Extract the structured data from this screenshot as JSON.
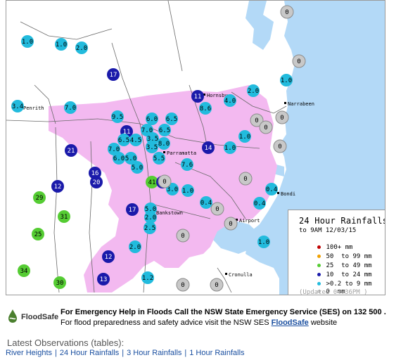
{
  "map": {
    "places": [
      {
        "name": "Penrith"
      },
      {
        "name": "Hornsby"
      },
      {
        "name": "Narrabeen"
      },
      {
        "name": "Parramatta"
      },
      {
        "name": "Bankstown"
      },
      {
        "name": "Bondi"
      },
      {
        "name": "Airport"
      },
      {
        "name": "Cronulla"
      }
    ],
    "stations": [
      {
        "label": "1.0",
        "cls": "0.2-9"
      },
      {
        "label": "1.0",
        "cls": "0.2-9"
      },
      {
        "label": "2.0",
        "cls": "0.2-9"
      },
      {
        "label": "17",
        "cls": "10-24"
      },
      {
        "label": "1.0",
        "cls": "0.2-9"
      },
      {
        "label": "11",
        "cls": "10-24"
      },
      {
        "label": "4.0",
        "cls": "0.2-9"
      },
      {
        "label": "2.0",
        "cls": "0.2-9"
      },
      {
        "label": "3.4",
        "cls": "0.2-9"
      },
      {
        "label": "7.0",
        "cls": "0.2-9"
      },
      {
        "label": "9.5",
        "cls": "0.2-9"
      },
      {
        "label": "6.0",
        "cls": "0.2-9"
      },
      {
        "label": "6.5",
        "cls": "0.2-9"
      },
      {
        "label": "8.6",
        "cls": "0.2-9"
      },
      {
        "label": "11",
        "cls": "10-24"
      },
      {
        "label": "7.0",
        "cls": "0.2-9"
      },
      {
        "label": "6.5",
        "cls": "0.2-9"
      },
      {
        "label": "6.5",
        "cls": "0.2-9"
      },
      {
        "label": "4.5",
        "cls": "0.2-9"
      },
      {
        "label": "3.5",
        "cls": "0.2-9"
      },
      {
        "label": "8.0",
        "cls": "0.2-9"
      },
      {
        "label": "3.5",
        "cls": "0.2-9"
      },
      {
        "label": "7.0",
        "cls": "0.2-9"
      },
      {
        "label": "6.0",
        "cls": "0.2-9"
      },
      {
        "label": "5.0",
        "cls": "0.2-9"
      },
      {
        "label": "5.0",
        "cls": "0.2-9"
      },
      {
        "label": "5.5",
        "cls": "0.2-9"
      },
      {
        "label": "21",
        "cls": "10-24"
      },
      {
        "label": "14",
        "cls": "10-24"
      },
      {
        "label": "1.0",
        "cls": "0.2-9"
      },
      {
        "label": "1.0",
        "cls": "0.2-9"
      },
      {
        "label": "7.6",
        "cls": "0.2-9"
      },
      {
        "label": "16",
        "cls": "10-24"
      },
      {
        "label": "20",
        "cls": "10-24"
      },
      {
        "label": "41",
        "cls": "25-49"
      },
      {
        "label": "11",
        "cls": "10-24"
      },
      {
        "label": "0.2",
        "cls": "0"
      },
      {
        "label": "12",
        "cls": "10-24"
      },
      {
        "label": "3.0",
        "cls": "0.2-9"
      },
      {
        "label": "1.0",
        "cls": "0.2-9"
      },
      {
        "label": "0.4",
        "cls": "0.2-9"
      },
      {
        "label": "29",
        "cls": "25-49"
      },
      {
        "label": "0.4",
        "cls": "0.2-9"
      },
      {
        "label": "0.4",
        "cls": "0.2-9"
      },
      {
        "label": "31",
        "cls": "25-49"
      },
      {
        "label": "17",
        "cls": "10-24"
      },
      {
        "label": "5.0",
        "cls": "0.2-9"
      },
      {
        "label": "2.0",
        "cls": "0.2-9"
      },
      {
        "label": "25",
        "cls": "25-49"
      },
      {
        "label": "2.5",
        "cls": "0.2-9"
      },
      {
        "label": "1.0",
        "cls": "0.2-9"
      },
      {
        "label": "2.0",
        "cls": "0.2-9"
      },
      {
        "label": "12",
        "cls": "10-24"
      },
      {
        "label": "34",
        "cls": "25-49"
      },
      {
        "label": "1.2",
        "cls": "0.2-9"
      },
      {
        "label": "30",
        "cls": "25-49"
      },
      {
        "label": "13",
        "cls": "10-24"
      },
      {
        "label": "",
        "cls": "0"
      },
      {
        "label": "",
        "cls": "0"
      },
      {
        "label": "",
        "cls": "0"
      },
      {
        "label": "",
        "cls": "0"
      },
      {
        "label": "",
        "cls": "0"
      },
      {
        "label": "",
        "cls": "0"
      },
      {
        "label": "",
        "cls": "0"
      },
      {
        "label": "",
        "cls": "0"
      },
      {
        "label": "",
        "cls": "0"
      },
      {
        "label": "",
        "cls": "0"
      },
      {
        "label": "",
        "cls": "0"
      },
      {
        "label": "",
        "cls": "0"
      },
      {
        "label": "",
        "cls": "0"
      },
      {
        "label": "",
        "cls": "0"
      },
      {
        "label": "",
        "cls": "0"
      },
      {
        "label": "",
        "cls": "0"
      }
    ],
    "colors": {
      "water": "#b3d9f7",
      "urban": "#f3b9f0",
      "land": "#ffffff",
      "road": "#6a6a6a",
      "c100": "#c00000",
      "c50": "#f0a000",
      "c25": "#55cc33",
      "c10": "#1a1aaa",
      "c02": "#22bbdd",
      "c0": "#c8c8c8"
    }
  },
  "legend": {
    "title": "24 Hour Rainfalls",
    "subtitle": "to 9AM 12/03/15",
    "rows": [
      {
        "label": "100+ mm",
        "color": "#c00000"
      },
      {
        "label": "50  to 99 mm",
        "color": "#f0a000"
      },
      {
        "label": "25  to 49 mm",
        "color": "#55cc33"
      },
      {
        "label": "10  to 24 mm",
        "color": "#1a1aaa"
      },
      {
        "label": ">0.2 to 9 mm",
        "color": "#22bbdd"
      },
      {
        "label": "0  mm",
        "color": "#c8c8c8"
      }
    ],
    "updated": "(Updated 04:36PM  )"
  },
  "footer": {
    "logo_text": "FloodSafe",
    "line1": "For Emergency Help in Floods Call the NSW State Emergency Service (SES) on 132 500 .",
    "line2_pre": "For flood preparedness and safety advice visit the NSW SES ",
    "line2_link": "FloodSafe",
    "line2_post": " website"
  },
  "latest": {
    "heading": "Latest Observations (tables):",
    "tabs": [
      "River Heights",
      "24 Hour Rainfalls",
      "3 Hour Rainfalls",
      "1 Hour Rainfalls"
    ]
  }
}
